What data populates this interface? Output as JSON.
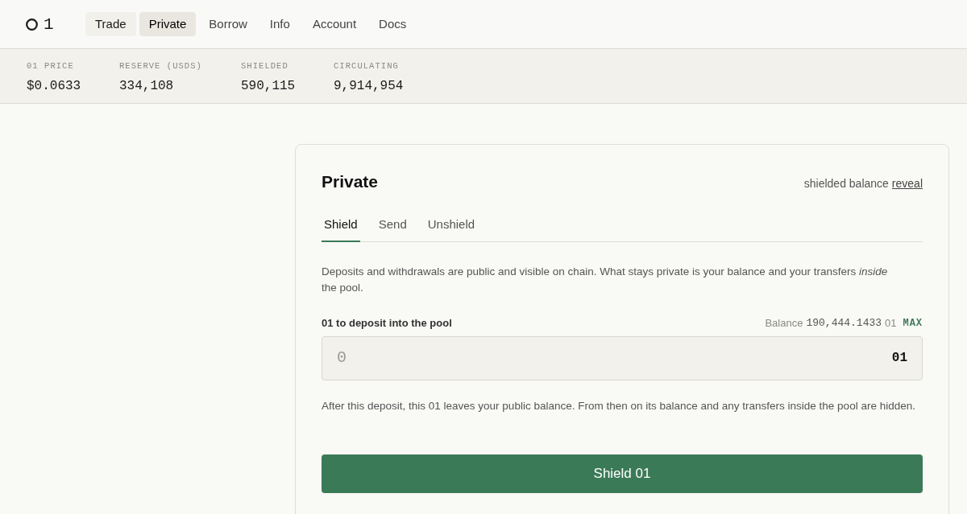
{
  "header": {
    "logo": "1",
    "nav": [
      {
        "label": "Trade",
        "selected": false,
        "hovered": true
      },
      {
        "label": "Private",
        "selected": true,
        "hovered": false
      },
      {
        "label": "Borrow",
        "selected": false,
        "hovered": false
      },
      {
        "label": "Info",
        "selected": false,
        "hovered": false
      },
      {
        "label": "Account",
        "selected": false,
        "hovered": false
      },
      {
        "label": "Docs",
        "selected": false,
        "hovered": false
      }
    ]
  },
  "stats": [
    {
      "label": "01 PRICE",
      "value": "$0.0633"
    },
    {
      "label": "RESERVE (USDS)",
      "value": "334,108"
    },
    {
      "label": "SHIELDED",
      "value": "590,115"
    },
    {
      "label": "CIRCULATING",
      "value": "9,914,954"
    }
  ],
  "card": {
    "title": "Private",
    "balance_label": "shielded balance",
    "reveal_link": "reveal",
    "tabs": [
      {
        "label": "Shield",
        "selected": true
      },
      {
        "label": "Send",
        "selected": false
      },
      {
        "label": "Unshield",
        "selected": false
      }
    ],
    "intro": "Deposits and withdrawals are public and visible on chain. What stays private is your balance and your transfers *inside* the pool.",
    "amount_field": {
      "label": "01 to deposit into the pool",
      "balance_label": "Balance",
      "balance_value": "190,444.1433",
      "balance_unit": "01",
      "max_button": "MAX",
      "placeholder": "0",
      "unit": "01"
    },
    "note": "After this deposit, this 01 leaves your public balance. From then on its balance and any transfers inside the pool are hidden.",
    "submit_button": "Shield 01"
  }
}
